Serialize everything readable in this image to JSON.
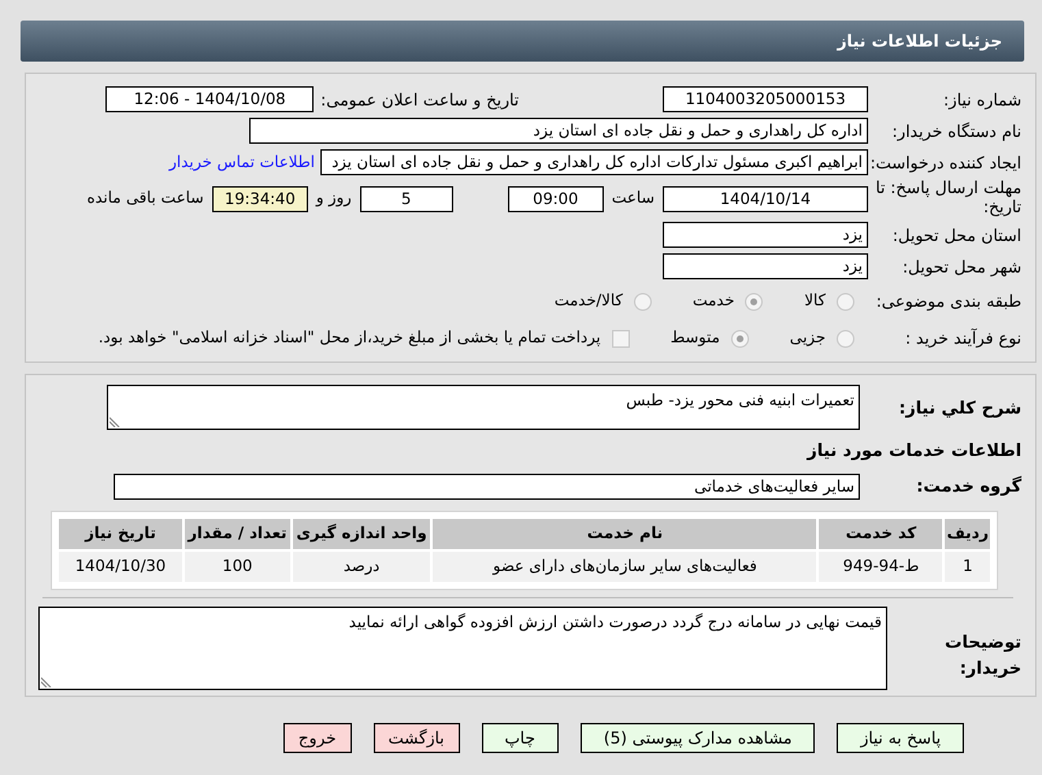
{
  "header": {
    "title": "جزئیات اطلاعات نیاز"
  },
  "need_number": {
    "label": "شماره نیاز:",
    "value": "1104003205000153"
  },
  "announce_date": {
    "label": "تاريخ و ساعت اعلان عمومی:",
    "value": "1404/10/08 - 12:06"
  },
  "buyer_org": {
    "label": "نام دستگاه خریدار:",
    "value": "اداره کل راهداری و حمل و نقل جاده ای استان یزد"
  },
  "requester": {
    "label": "ایجاد کننده درخواست:",
    "value": "ابراهیم اکبری مسئول تدارکات اداره کل راهداری و حمل و نقل جاده ای استان یزد",
    "link": "اطلاعات تماس خریدار"
  },
  "deadline": {
    "label": "مهلت ارسال پاسخ: تا تاریخ:",
    "date": "1404/10/14",
    "time_label": "ساعت",
    "time": "09:00",
    "days": "5",
    "days_label": "روز و",
    "remaining": "19:34:40",
    "remaining_label": "ساعت باقی مانده"
  },
  "province": {
    "label": "استان محل تحویل:",
    "value": "یزد"
  },
  "city": {
    "label": "شهر محل تحویل:",
    "value": "یزد"
  },
  "category": {
    "label": "طبقه بندی موضوعی:",
    "options": [
      {
        "label": "کالا",
        "selected": false
      },
      {
        "label": "خدمت",
        "selected": true
      },
      {
        "label": "کالا/خدمت",
        "selected": false
      }
    ]
  },
  "process": {
    "label": "نوع فرآیند خرید :",
    "options": [
      {
        "label": "جزیی",
        "selected": false
      },
      {
        "label": "متوسط",
        "selected": true
      }
    ],
    "payment": {
      "checked": false,
      "label": "پرداخت تمام یا بخشی از مبلغ خرید،از محل \"اسناد خزانه اسلامی\" خواهد بود."
    }
  },
  "description": {
    "label": "شرح کلي نیاز:",
    "value": "تعمیرات ابنیه فنی محور یزد- طبس"
  },
  "services_title": "اطلاعات خدمات مورد نیاز",
  "service_group": {
    "label": "گروه خدمت:",
    "value": "سایر فعالیت‌های خدماتی"
  },
  "table": {
    "columns": [
      "ردیف",
      "کد خدمت",
      "نام خدمت",
      "واحد اندازه گیری",
      "تعداد / مقدار",
      "تاریخ نیاز"
    ],
    "rows": [
      [
        "1",
        "ط-94-949",
        "فعالیت‌های سایر سازمان‌های دارای عضو",
        "درصد",
        "100",
        "1404/10/30"
      ]
    ]
  },
  "buyer_notes": {
    "label": "توضیحات خریدار:",
    "value": "قیمت نهایی در سامانه درج گردد درصورت داشتن ارزش افزوده گواهی ارائه نمایید"
  },
  "buttons": [
    {
      "label": "پاسخ به نیاز",
      "kind": "normal"
    },
    {
      "label": "مشاهده مدارک پیوستی (5)",
      "kind": "normal"
    },
    {
      "label": "چاپ",
      "kind": "normal"
    },
    {
      "label": "بازگشت",
      "kind": "danger"
    },
    {
      "label": "خروج",
      "kind": "danger"
    }
  ]
}
